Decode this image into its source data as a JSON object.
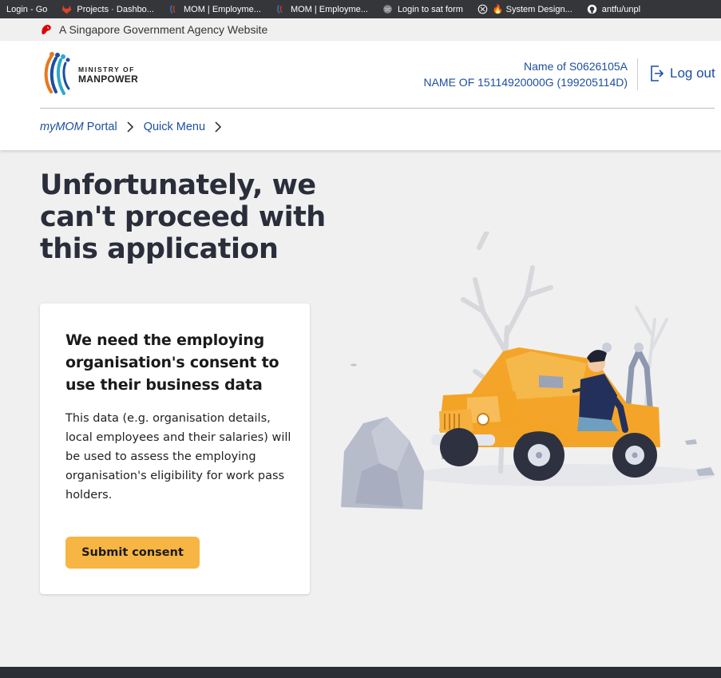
{
  "bookmarks": [
    {
      "label": "Login - Go",
      "icon": "none"
    },
    {
      "label": "Projects · Dashbo...",
      "icon": "gitlab-icon"
    },
    {
      "label": "MOM | Employme...",
      "icon": "mom-icon"
    },
    {
      "label": "MOM | Employme...",
      "icon": "mom-icon"
    },
    {
      "label": "Login to sat form",
      "icon": "globe-icon"
    },
    {
      "label": "🔥 System Design...",
      "icon": "circle-x-icon"
    },
    {
      "label": "antfu/unpl",
      "icon": "github-icon"
    }
  ],
  "gov_banner": {
    "text": "A Singapore Government Agency Website"
  },
  "logo": {
    "line1": "MINISTRY OF",
    "line2": "MANPOWER"
  },
  "user": {
    "name": "Name of S0626105A",
    "org": "NAME OF 15114920000G (199205114D)"
  },
  "logout_label": "Log out",
  "breadcrumb": {
    "portal_prefix": "myMOM",
    "portal_suffix": " Portal",
    "quick_menu": "Quick Menu"
  },
  "headline": "Unfortunately, we can't proceed with this application",
  "card": {
    "title": "We need the employing organisation's consent to use their business data",
    "body": "This data (e.g. organisation details, local employees and their salaries) will be used to assess the employing organisation's eligibility for work pass holders.",
    "button_label": "Submit consent"
  },
  "colors": {
    "link": "#1d4ea3",
    "accent_button": "#f7b543",
    "bookmarks_bg": "#35363a",
    "page_bg": "#f0f0f0"
  }
}
